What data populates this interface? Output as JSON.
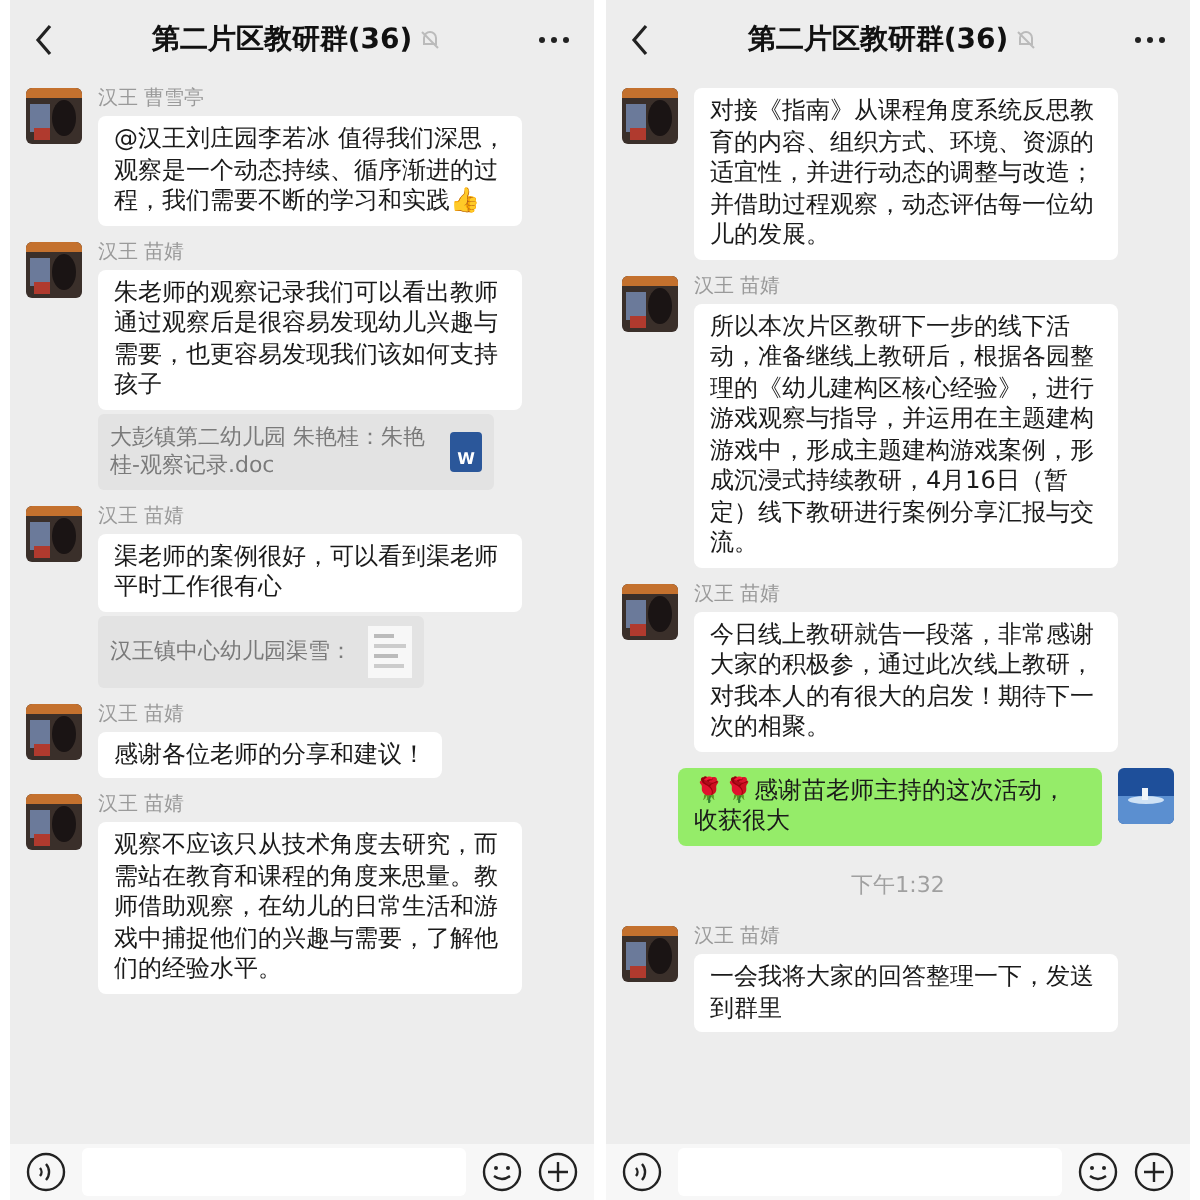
{
  "panels": [
    {
      "header": {
        "title": "第二片区教研群(36)",
        "muted": true
      },
      "messages": [
        {
          "kind": "text",
          "sender": "汉王 曹雪亭",
          "text": "@汉王刘庄园李若冰  值得我们深思，观察是一个动态持续、循序渐进的过程，我们需要不断的学习和实践👍"
        },
        {
          "kind": "text",
          "sender": "汉王 苗婧",
          "text": "朱老师的观察记录我们可以看出教师通过观察后是很容易发现幼儿兴趣与需要，也更容易发现我们该如何支持孩子",
          "quote": {
            "kind": "file",
            "text": "大彭镇第二幼儿园 朱艳桂：朱艳桂-观察记录.doc",
            "icon_label": "W"
          }
        },
        {
          "kind": "text",
          "sender": "汉王 苗婧",
          "text": "渠老师的案例很好，可以看到渠老师平时工作很有心",
          "quote": {
            "text": "汉王镇中心幼儿园渠雪："
          }
        },
        {
          "kind": "text",
          "sender": "汉王 苗婧",
          "text": "感谢各位老师的分享和建议！"
        },
        {
          "kind": "text",
          "sender": "汉王 苗婧",
          "text": "观察不应该只从技术角度去研究，而需站在教育和课程的角度来思量。教师借助观察，在幼儿的日常生活和游戏中捕捉他们的兴趣与需要，了解他们的经验水平。"
        }
      ]
    },
    {
      "header": {
        "title": "第二片区教研群(36)",
        "muted": true
      },
      "messages": [
        {
          "kind": "text",
          "text": "对接《指南》从课程角度系统反思教育的内容、组织方式、环境、资源的适宜性，并进行动态的调整与改造；并借助过程观察，动态评估每一位幼儿的发展。"
        },
        {
          "kind": "text",
          "sender": "汉王 苗婧",
          "text": "所以本次片区教研下一步的线下活动，准备继线上教研后，根据各园整理的《幼儿建构区核心经验》，进行游戏观察与指导，并运用在主题建构游戏中，形成主题建构游戏案例，形成沉浸式持续教研，4月16日（暂定）线下教研进行案例分享汇报与交流。"
        },
        {
          "kind": "text",
          "sender": "汉王 苗婧",
          "text": "今日线上教研就告一段落，非常感谢大家的积极参，通过此次线上教研，对我本人的有很大的启发！期待下一次的相聚。"
        },
        {
          "kind": "self",
          "text": "🌹🌹感谢苗老师主持的这次活动，收获很大"
        },
        {
          "kind": "time",
          "text": "下午1:32"
        },
        {
          "kind": "text",
          "sender": "汉王 苗婧",
          "text": "一会我将大家的回答整理一下，发送到群里"
        }
      ]
    }
  ]
}
